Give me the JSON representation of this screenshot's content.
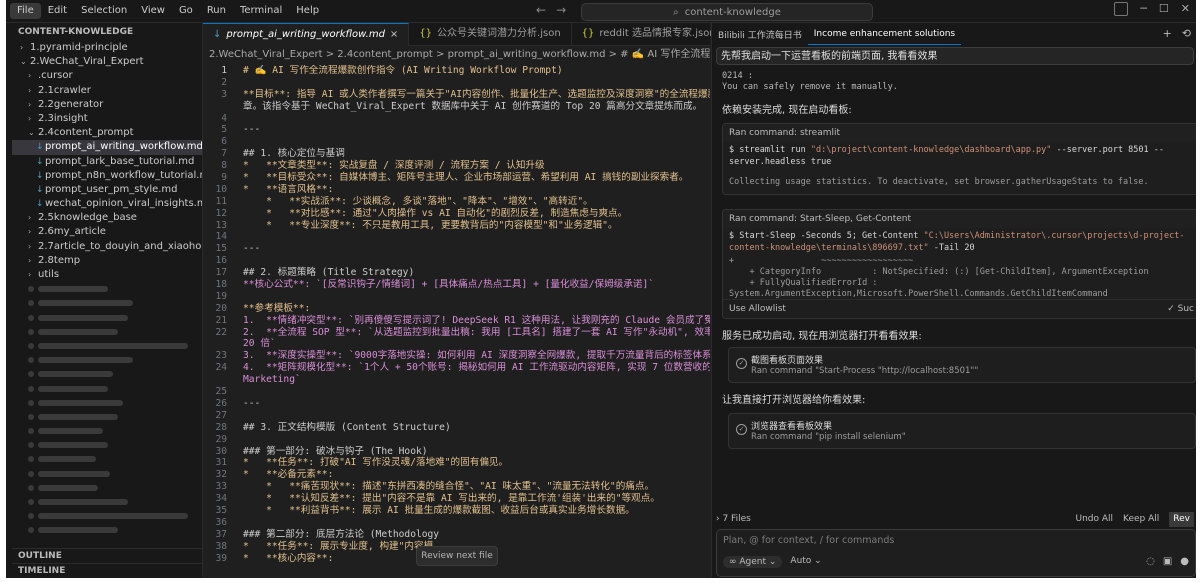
{
  "menu": [
    "File",
    "Edit",
    "Selection",
    "View",
    "Go",
    "Run",
    "Terminal",
    "Help"
  ],
  "search": "content-knowledge",
  "sidebar": {
    "title": "CONTENT-KNOWLEDGE",
    "items": [
      {
        "label": "1.pyramid-principle",
        "indent": 1,
        "type": "folder",
        "open": false
      },
      {
        "label": "2.WeChat_Viral_Expert",
        "indent": 1,
        "type": "folder",
        "open": true
      },
      {
        "label": ".cursor",
        "indent": 2,
        "type": "folder",
        "open": false
      },
      {
        "label": "2.1crawler",
        "indent": 2,
        "type": "folder",
        "open": false
      },
      {
        "label": "2.2generator",
        "indent": 2,
        "type": "folder",
        "open": false
      },
      {
        "label": "2.3insight",
        "indent": 2,
        "type": "folder",
        "open": false
      },
      {
        "label": "2.4content_prompt",
        "indent": 2,
        "type": "folder",
        "open": true
      },
      {
        "label": "prompt_ai_writing_workflow.md",
        "indent": 3,
        "type": "file",
        "selected": true
      },
      {
        "label": "prompt_lark_base_tutorial.md",
        "indent": 3,
        "type": "file"
      },
      {
        "label": "prompt_n8n_workflow_tutorial.md",
        "indent": 3,
        "type": "file"
      },
      {
        "label": "prompt_user_pm_style.md",
        "indent": 3,
        "type": "file"
      },
      {
        "label": "wechat_opinion_viral_insights.md",
        "indent": 3,
        "type": "file"
      },
      {
        "label": "2.5knowledge_base",
        "indent": 2,
        "type": "folder",
        "open": false
      },
      {
        "label": "2.6my_article",
        "indent": 2,
        "type": "folder",
        "open": false
      },
      {
        "label": "2.7article_to_douyin_and_xiaohongshu",
        "indent": 2,
        "type": "folder",
        "open": false
      },
      {
        "label": "2.8temp",
        "indent": 2,
        "type": "folder",
        "open": false
      },
      {
        "label": "utils",
        "indent": 2,
        "type": "folder",
        "open": false
      }
    ],
    "outline": "OUTLINE",
    "timeline": "TIMELINE"
  },
  "editor": {
    "tabs": [
      {
        "label": "prompt_ai_writing_workflow.md",
        "icon": "markdown",
        "active": true
      },
      {
        "label": "公众号关键词潜力分析.json",
        "icon": "json",
        "active": false
      },
      {
        "label": "reddit 选品情报专家.json",
        "icon": "json",
        "active": false
      }
    ],
    "breadcrumb": "2.WeChat_Viral_Expert > 2.4content_prompt > prompt_ai_writing_workflow.md > # ✍️ AI 写作全流程爆款创作指令 (AI Writing W",
    "lines": [
      {
        "n": "1",
        "t": "# ✍️ AI 写作全流程爆款创作指令 (AI Writing Workflow Prompt)",
        "s": "h",
        "cur": true
      },
      {
        "n": "2",
        "t": "",
        "s": "c"
      },
      {
        "n": "3",
        "t": "**目标**: 指导 AI 或人类作者撰写一篇关于\"AI内容创作、批量化生产、选题监控及深度洞察\"的全流程爆款文",
        "s": "b"
      },
      {
        "n": "",
        "t": "章。该指令基于 WeChat_Viral_Expert 数据库中关于 AI 创作赛道的 Top 20 篇高分文章提炼而成。",
        "s": "c"
      },
      {
        "n": "4",
        "t": "",
        "s": "c"
      },
      {
        "n": "5",
        "t": "---",
        "s": "c"
      },
      {
        "n": "6",
        "t": "",
        "s": "c"
      },
      {
        "n": "7",
        "t": "## 1. 核心定位与基调",
        "s": "c"
      },
      {
        "n": "8",
        "t": "*   **文章类型**: 实战复盘 / 深度评测 / 流程方案 / 认知升级",
        "s": "b"
      },
      {
        "n": "9",
        "t": "*   **目标受众**: 自媒体博主、矩阵号主理人、企业市场部运营、希望利用 AI 搞钱的副业探索者。",
        "s": "b"
      },
      {
        "n": "10",
        "t": "*   **语言风格**:",
        "s": "b"
      },
      {
        "n": "11",
        "t": "    *   **实战派**: 少谈概念, 多谈\"落地\"、\"降本\"、\"增效\"、\"高转近\"。",
        "s": "b"
      },
      {
        "n": "12",
        "t": "    *   **对比感**: 通过\"人肉操作 vs AI 自动化\"的剧烈反差, 制造焦虑与爽点。",
        "s": "b"
      },
      {
        "n": "13",
        "t": "    *   **专业深度**: 不只是教用工具, 更要教背后的\"内容模型\"和\"业务逻辑\"。",
        "s": "b"
      },
      {
        "n": "14",
        "t": "",
        "s": "c"
      },
      {
        "n": "15",
        "t": "---",
        "s": "c"
      },
      {
        "n": "16",
        "t": "",
        "s": "c"
      },
      {
        "n": "17",
        "t": "## 2. 标题策略 (Title Strategy)",
        "s": "c"
      },
      {
        "n": "18",
        "t": "**核心公式**: `[反常识钩子/情绪词] + [具体痛点/热点工具] + [量化收益/保姆级承诺]`",
        "s": "p"
      },
      {
        "n": "19",
        "t": "",
        "s": "c"
      },
      {
        "n": "20",
        "t": "**参考模板**:",
        "s": "b"
      },
      {
        "n": "21",
        "t": "1.  **情绪冲突型**: `别再傻傻写提示词了! DeepSeek R1 这种用法, 让我刚充的 Claude 会员成了冤大头`",
        "s": "p"
      },
      {
        "n": "22",
        "t": "2.  **全流程 SOP 型**: `从选题监控到批量出稿: 我用 [工具名] 搭建了一套 AI 写作\"永动机\", 效率提升",
        "s": "p"
      },
      {
        "n": "",
        "t": "20 倍`",
        "s": "p"
      },
      {
        "n": "23",
        "t": "3.  **深度实操型**: `9000字落地实操: 如何利用 AI 深度洞察全网爆款, 提取千万流量背后的标签体系`",
        "s": "p"
      },
      {
        "n": "24",
        "t": "4.  **矩阵规模化型**: `1个人 + 50个账号: 揭秘如何用 AI 工作流驱动内容矩阵, 实现 7 位数营收的 Vibe",
        "s": "p"
      },
      {
        "n": "",
        "t": "Marketing`",
        "s": "p"
      },
      {
        "n": "25",
        "t": "",
        "s": "c"
      },
      {
        "n": "26",
        "t": "---",
        "s": "c"
      },
      {
        "n": "27",
        "t": "",
        "s": "c"
      },
      {
        "n": "28",
        "t": "## 3. 正文结构模版 (Content Structure)",
        "s": "c"
      },
      {
        "n": "29",
        "t": "",
        "s": "c"
      },
      {
        "n": "30",
        "t": "### 第一部分: 破冰与钩子 (The Hook)",
        "s": "c"
      },
      {
        "n": "31",
        "t": "*   **任务**: 打破\"AI 写作没灵魂/落地难\"的固有偏见。",
        "s": "b"
      },
      {
        "n": "32",
        "t": "*   **必备元素**:",
        "s": "b"
      },
      {
        "n": "33",
        "t": "    *   **痛苦现状**: 描述\"东拼西凑的缝合怪\"、\"AI 味太重\"、\"流量无法转化\"的痛点。",
        "s": "b"
      },
      {
        "n": "34",
        "t": "    *   **认知反差**: 提出\"内容不是靠 AI 写出来的, 是靠工作流'组装'出来的\"等观点。",
        "s": "b"
      },
      {
        "n": "35",
        "t": "    *   **利益背书**: 展示 AI 批量生成的爆款截图、收益后台或真实业务增长数据。",
        "s": "b"
      },
      {
        "n": "36",
        "t": "",
        "s": "c"
      },
      {
        "n": "37",
        "t": "### 第二部分: 底层方法论 (Methodology",
        "s": "c"
      },
      {
        "n": "38",
        "t": "*   **任务**: 展示专业度, 构建\"内容模",
        "s": "b"
      },
      {
        "n": "39",
        "t": "*   **核心内容**:",
        "s": "b"
      }
    ],
    "review_next": "Review next file"
  },
  "chat": {
    "tabs": [
      {
        "label": "Bilibili 工作流每日书",
        "active": false
      },
      {
        "label": "Income enhancement solutions",
        "active": true
      }
    ],
    "user_message": "先帮我启动一下运营看板的前端页面, 我看看效果",
    "terminal_tail": [
      "0214 :",
      "You can safely remove it manually."
    ],
    "msg1": "依赖安装完成, 现在启动看板:",
    "cmd1": {
      "title": "Ran command: streamlit",
      "prefix": "$ streamlit run ",
      "path": "\"d:\\project\\content-knowledge\\dashboard\\app.py\"",
      "args": " --server.port 8501 --server.headless true",
      "output": "Collecting usage statistics. To deactivate, set browser.gatherUsageStats to false."
    },
    "cmd2": {
      "title": "Ran command: Start-Sleep, Get-Content",
      "prefix": "$ Start-Sleep -Seconds 5; Get-Content ",
      "path": "\"C:\\Users\\Administrator\\.cursor\\projects\\d-project-content-knowledge\\terminals\\896697.txt\"",
      "args": " -Tail 20",
      "out1": "+                 ~~~~~~~~~~~~~~~~~~",
      "out2": "    + CategoryInfo          : NotSpecified: (:) [Get-ChildItem], ArgumentException",
      "out3": "    + FullyQualifiedErrorId : System.ArgumentException,Microsoft.PowerShell.Commands.GetChildItemCommand",
      "allow": "Use Allowlist",
      "status": "Suc"
    },
    "msg2": "服务已成功启动, 现在用浏览器打开看看效果:",
    "tool1": {
      "title": "截图看板页面效果",
      "cmd": "Ran command \"Start-Process \"http://localhost:8501\"\""
    },
    "msg3": "让我直接打开浏览器给你看效果:",
    "tool2": {
      "title": "浏览器查看看板效果",
      "cmd": "Ran command \"pip install selenium\""
    },
    "files": "7 Files",
    "undo_all": "Undo All",
    "keep_all": "Keep All",
    "review": "Rev",
    "placeholder": "Plan, @ for context, / for commands",
    "agent": "Agent",
    "auto": "Auto"
  }
}
